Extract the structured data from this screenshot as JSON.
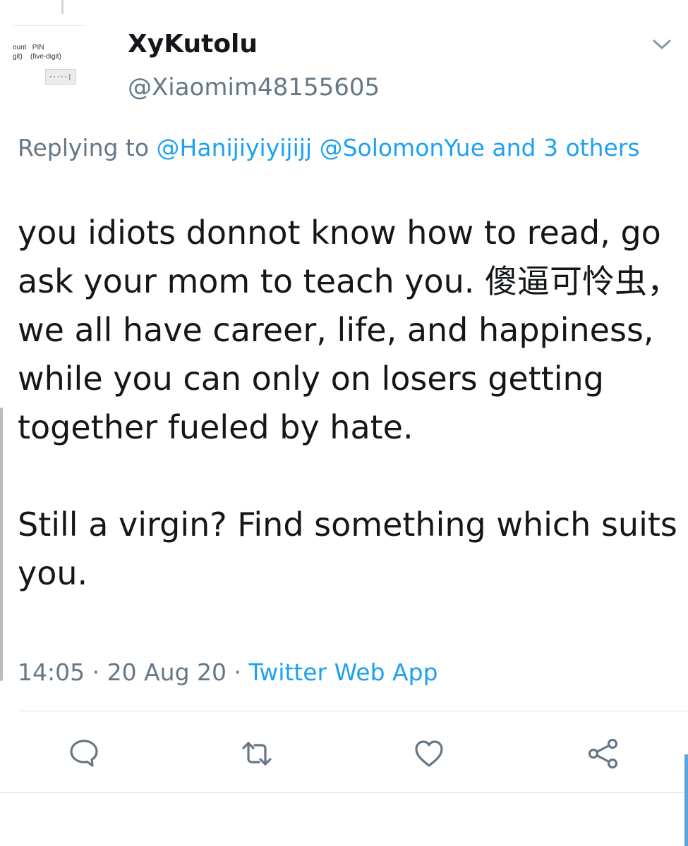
{
  "avatar": {
    "text_line_1": "ount   PIN",
    "text_line_2": "git)    (five-digit)",
    "text_line_3": "·····|"
  },
  "user": {
    "name": "XyKutolu",
    "handle": "@Xiaomim48155605"
  },
  "reply": {
    "prefix": "Replying to",
    "mentions": "@Hanijiyiyijijj @SolomonYue and 3 others"
  },
  "tweet": {
    "paragraph_1": "you idiots donnot know how to read, go ask your mom to teach you. 傻逼可怜虫，we all have career, life, and happiness, while you can only on losers getting together fueled by hate.",
    "paragraph_2": "Still a virgin? Find something which suits you."
  },
  "meta": {
    "time": "14:05",
    "separator_1": "·",
    "date": "20 Aug 20",
    "separator_2": "·",
    "source": "Twitter Web App"
  },
  "actions": {
    "reply_icon": "reply-icon",
    "retweet_icon": "retweet-icon",
    "like_icon": "like-icon",
    "share_icon": "share-icon"
  },
  "colors": {
    "link": "#1da1f2",
    "secondary_text": "#657786",
    "primary_text": "#14171a",
    "icon": "#657786"
  }
}
